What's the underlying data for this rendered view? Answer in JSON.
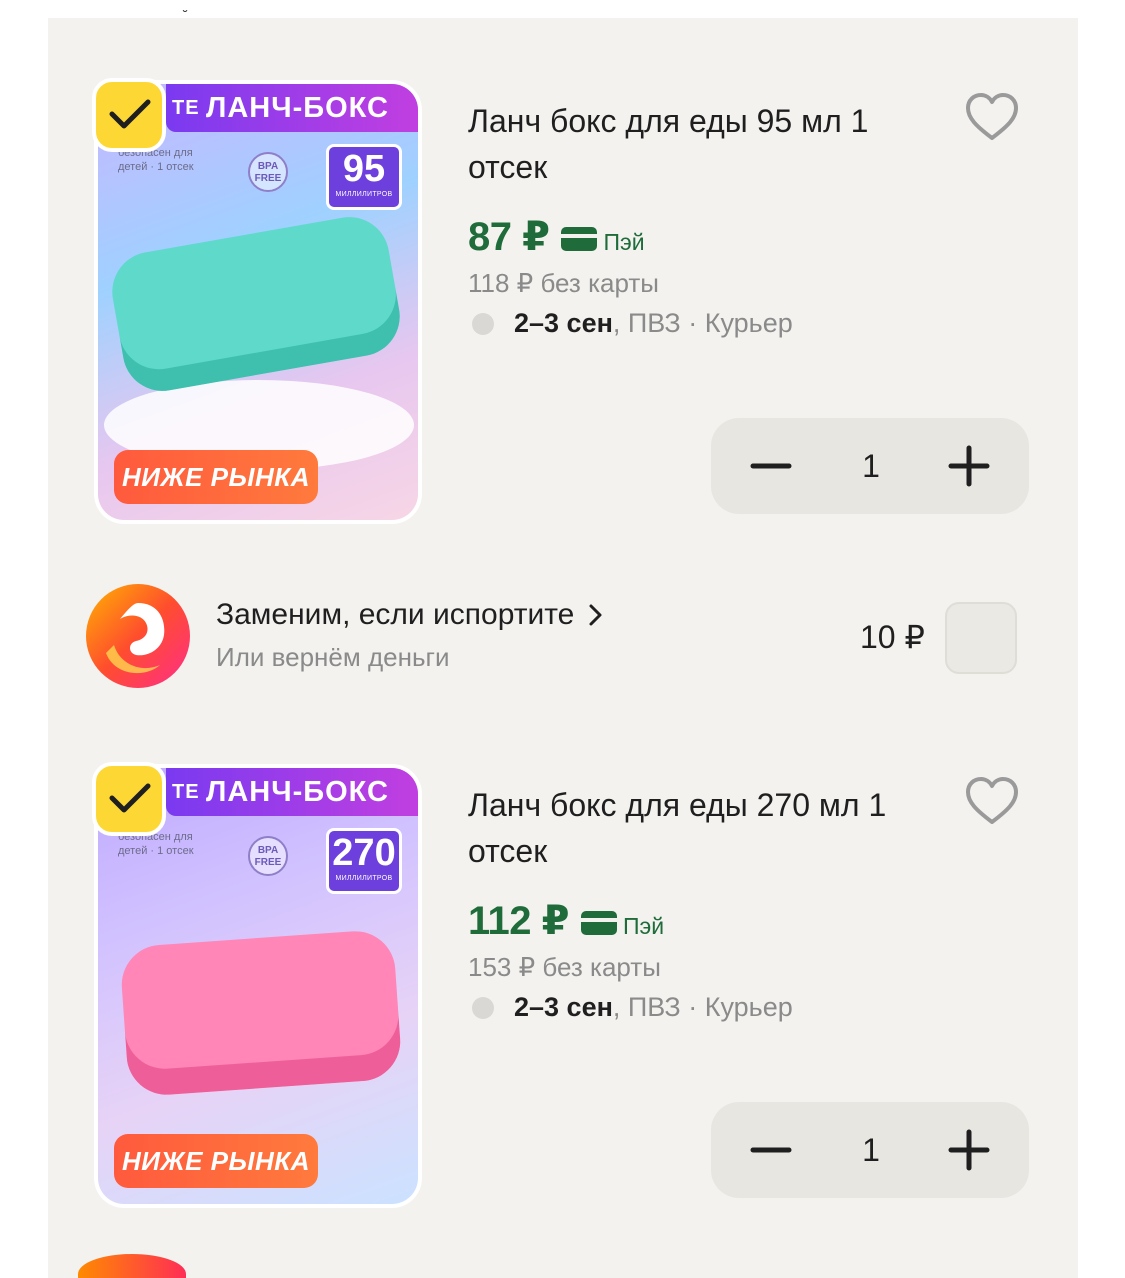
{
  "colors": {
    "panel_bg": "#f3f2ef",
    "price_green": "#1f6b3a",
    "muted_text": "#8a8a8a",
    "check_yellow": "#fdd835",
    "badge_orange": "#ff5a3d"
  },
  "products": [
    {
      "image": {
        "banner_prefix": "ТЕ",
        "banner": "ЛАНЧ-БОКС",
        "side_text": "безопасен для детей · 1 отсек",
        "bpa": "BPA FREE",
        "volume": "95",
        "volume_unit": "МИЛЛИЛИТРОВ",
        "badge": "НИЖЕ РЫНКА"
      },
      "selected": true,
      "title": "Ланч бокс для еды 95 мл 1 отсек",
      "price": "87 ₽",
      "pay_label": "Пэй",
      "old_price": "118 ₽  без карты",
      "delivery_date": "2–3 сен",
      "delivery_options": ", ПВЗ · Курьер",
      "quantity": "1",
      "icons": {
        "favorite": "heart-icon",
        "check": "check-icon",
        "minus": "minus-icon",
        "plus": "plus-icon",
        "card": "card-icon"
      }
    },
    {
      "image": {
        "banner_prefix": "ТЕ",
        "banner": "ЛАНЧ-БОКС",
        "side_text": "безопасен для детей · 1 отсек",
        "bpa": "BPA FREE",
        "volume": "270",
        "volume_unit": "МИЛЛИЛИТРОВ",
        "badge": "НИЖЕ РЫНКА"
      },
      "selected": true,
      "title": "Ланч бокс для еды 270 мл 1 отсек",
      "price": "112 ₽",
      "pay_label": "Пэй",
      "old_price": "153 ₽  без карты",
      "delivery_date": "2–3 сен",
      "delivery_options": ", ПВЗ · Курьер",
      "quantity": "1",
      "icons": {
        "favorite": "heart-icon",
        "check": "check-icon",
        "minus": "minus-icon",
        "plus": "plus-icon",
        "card": "card-icon"
      }
    }
  ],
  "insurance": {
    "title": "Заменим, если испортите",
    "subtitle": "Или вернём деньги",
    "price": "10 ₽",
    "checked": false
  }
}
